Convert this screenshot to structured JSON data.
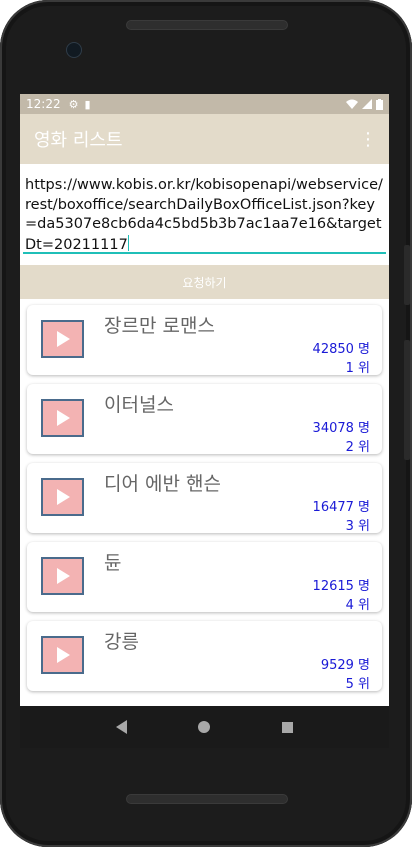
{
  "status_bar": {
    "time": "12:22",
    "settings_icon": "gear-icon",
    "sd_icon": "sd-card-icon"
  },
  "app_bar": {
    "title": "영화 리스트",
    "overflow_icon": "more-vert-icon"
  },
  "url_input": {
    "value": "https://www.kobis.or.kr/kobisopenapi/webservice/rest/boxoffice/searchDailyBoxOfficeList.json?key=da5307e8cb6da4c5bd5b3b7ac1aa7e16&targetDt=20211117"
  },
  "request_button": {
    "label": "요청하기"
  },
  "movies": [
    {
      "name": "장르만 로맨스",
      "audience": "42850 명",
      "rank": "1 위"
    },
    {
      "name": "이터널스",
      "audience": "34078 명",
      "rank": "2 위"
    },
    {
      "name": "디어 에반 핸슨",
      "audience": "16477 명",
      "rank": "3 위"
    },
    {
      "name": "듄",
      "audience": "12615 명",
      "rank": "4 위"
    },
    {
      "name": "강릉",
      "audience": "9529 명",
      "rank": "5 위"
    }
  ],
  "colors": {
    "app_bar": "#e3dbca",
    "status_bar": "#c2b9a9",
    "accent": "#1fbfb8",
    "thumb": "#f3b3b3",
    "number_text": "#1a1ad6"
  }
}
